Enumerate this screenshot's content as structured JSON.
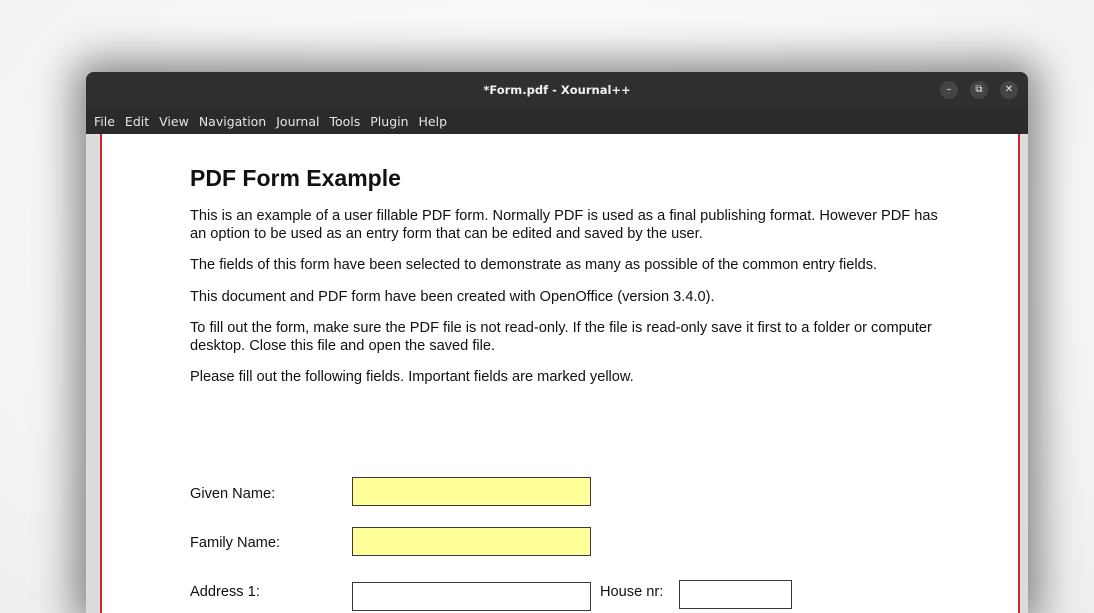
{
  "window": {
    "title": "*Form.pdf - Xournal++",
    "controls": [
      {
        "name": "minimize-icon",
        "glyph": "–"
      },
      {
        "name": "maximize-icon",
        "glyph": "⧉"
      },
      {
        "name": "close-icon",
        "glyph": "✕"
      }
    ]
  },
  "menu": [
    "File",
    "Edit",
    "View",
    "Navigation",
    "Journal",
    "Tools",
    "Plugin",
    "Help"
  ],
  "document": {
    "title": "PDF Form Example",
    "paragraphs": [
      "This is an example of a user fillable PDF form. Normally PDF is used as a final publishing format. However PDF has an option to be used as an entry form that can be edited and saved by the user.",
      "The fields of this form have been selected to demonstrate as many as possible of the common entry fields.",
      "This document and PDF form have been created with OpenOffice (version 3.4.0).",
      "To fill out the form, make sure the PDF file is not read-only. If the file is read-only save it first to a folder or computer desktop. Close this file and open the saved file.",
      "Please fill out the following fields. Important fields are marked yellow."
    ],
    "fields": {
      "given_name": {
        "label": "Given Name:",
        "value": ""
      },
      "family_name": {
        "label": "Family Name:",
        "value": ""
      },
      "address_1": {
        "label": "Address 1:",
        "value": ""
      },
      "house_nr": {
        "label": "House nr:",
        "value": ""
      }
    }
  },
  "colors": {
    "important_field": "#ffff99",
    "page_border": "#d0222a"
  }
}
